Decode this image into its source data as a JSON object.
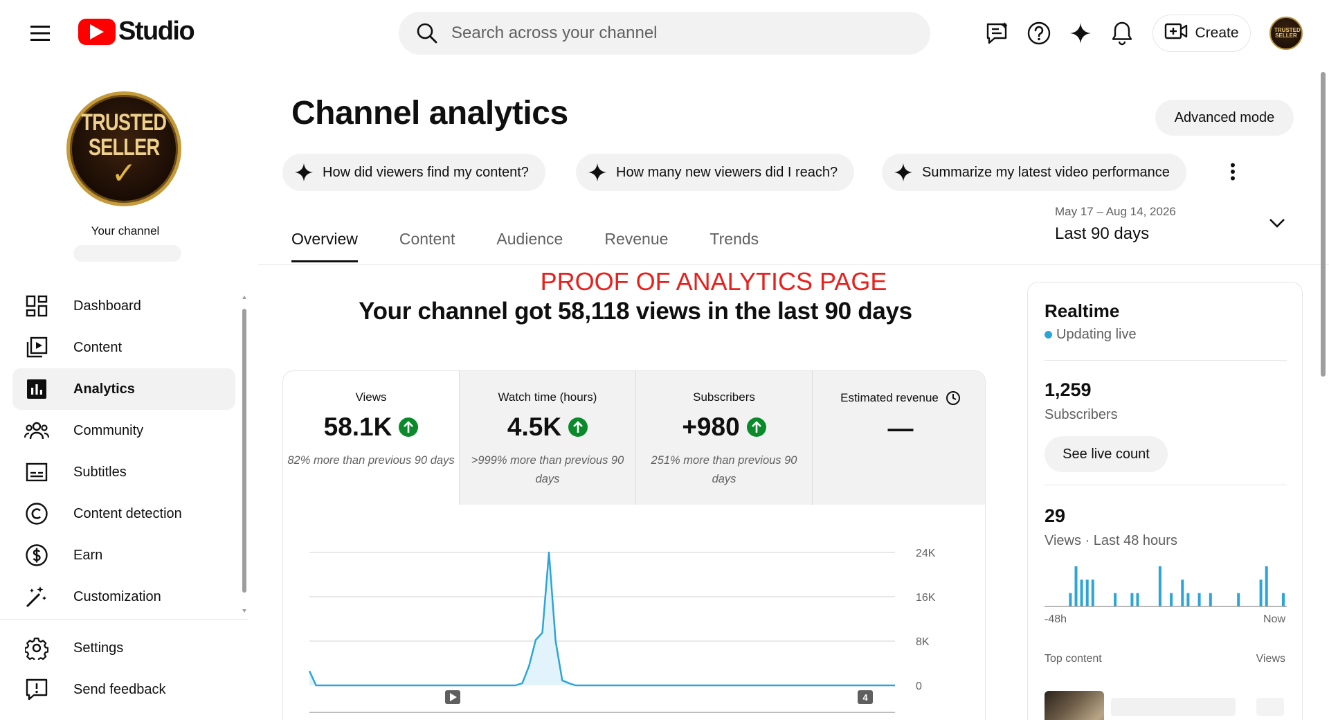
{
  "header": {
    "logo_text": "Studio",
    "search_placeholder": "Search across your channel",
    "create_label": "Create",
    "avatar_text": "TRUSTED SELLER"
  },
  "sidebar": {
    "avatar_text_line1": "TRUSTED",
    "avatar_text_line2": "SELLER",
    "your_channel": "Your channel",
    "items": [
      {
        "label": "Dashboard",
        "icon": "dashboard-icon",
        "active": false
      },
      {
        "label": "Content",
        "icon": "content-icon",
        "active": false
      },
      {
        "label": "Analytics",
        "icon": "analytics-icon",
        "active": true
      },
      {
        "label": "Community",
        "icon": "community-icon",
        "active": false
      },
      {
        "label": "Subtitles",
        "icon": "subtitles-icon",
        "active": false
      },
      {
        "label": "Content detection",
        "icon": "copyright-icon",
        "active": false
      },
      {
        "label": "Earn",
        "icon": "dollar-icon",
        "active": false
      },
      {
        "label": "Customization",
        "icon": "magic-wand-icon",
        "active": false
      }
    ],
    "bottom_items": [
      {
        "label": "Settings",
        "icon": "gear-icon"
      },
      {
        "label": "Send feedback",
        "icon": "feedback-icon"
      }
    ]
  },
  "main": {
    "title": "Channel analytics",
    "advanced_mode": "Advanced mode",
    "chips": [
      "How did viewers find my content?",
      "How many new viewers did I reach?",
      "Summarize my latest video performance"
    ],
    "date_range": "May 17 – Aug 14, 2026",
    "date_preset": "Last 90 days",
    "tabs": [
      "Overview",
      "Content",
      "Audience",
      "Revenue",
      "Trends"
    ],
    "active_tab": "Overview",
    "proof_label": "PROOF OF ANALYTICS PAGE",
    "headline": "Your channel got 58,118 views in the last 90 days",
    "metrics": [
      {
        "label": "Views",
        "value": "58.1K",
        "compare": "82% more than previous 90 days",
        "trend": "up"
      },
      {
        "label": "Watch time (hours)",
        "value": "4.5K",
        "compare": ">999% more than previous 90 days",
        "trend": "up"
      },
      {
        "label": "Subscribers",
        "value": "+980",
        "compare": "251% more than previous 90 days",
        "trend": "up"
      },
      {
        "label": "Estimated revenue",
        "value": "—",
        "compare": "",
        "trend": "none"
      }
    ],
    "chart_markers": {
      "video_marker": "▶",
      "count_marker": "4"
    }
  },
  "chart_data": {
    "type": "area",
    "series": [
      {
        "values": [
          2600,
          0,
          0,
          0,
          0,
          0,
          0,
          0,
          0,
          0,
          0,
          0,
          0,
          0,
          0,
          0,
          0,
          0,
          0,
          0,
          0,
          0,
          0,
          0,
          0,
          0,
          0,
          0,
          0,
          0,
          0,
          0,
          400,
          3500,
          8200,
          9500,
          24000,
          8000,
          900,
          400,
          0,
          0,
          0,
          0,
          0,
          0,
          0,
          0,
          0,
          0,
          0,
          0,
          0,
          0,
          0,
          0,
          0,
          0,
          0,
          0,
          0,
          0,
          0,
          0,
          0,
          0,
          0,
          0,
          0,
          0,
          0,
          0,
          0,
          0,
          0,
          0,
          0,
          0,
          0,
          0,
          0,
          0,
          0,
          0,
          0,
          0,
          0,
          0,
          0
        ]
      }
    ],
    "y_ticks": [
      "24K",
      "16K",
      "8K",
      "0"
    ],
    "ylim": [
      0,
      24000
    ],
    "grid": true,
    "accent": "#2ba5d8",
    "fill": "#e3f3fb"
  },
  "realtime": {
    "title": "Realtime",
    "live_label": "Updating live",
    "subscribers_value": "1,259",
    "subscribers_label": "Subscribers",
    "live_count_button": "See live count",
    "views_value": "29",
    "views_label": "Views · Last 48 hours",
    "axis_start": "-48h",
    "axis_end": "Now",
    "top_content_label": "Top content",
    "top_views_label": "Views",
    "bars": [
      0,
      0,
      0,
      0,
      1,
      3,
      2,
      2,
      2,
      0,
      0,
      0,
      1,
      0,
      0,
      1,
      1,
      0,
      0,
      0,
      3,
      0,
      1,
      0,
      2,
      1,
      0,
      1,
      0,
      1,
      0,
      0,
      0,
      0,
      1,
      0,
      0,
      0,
      2,
      3,
      0,
      0,
      1
    ]
  }
}
